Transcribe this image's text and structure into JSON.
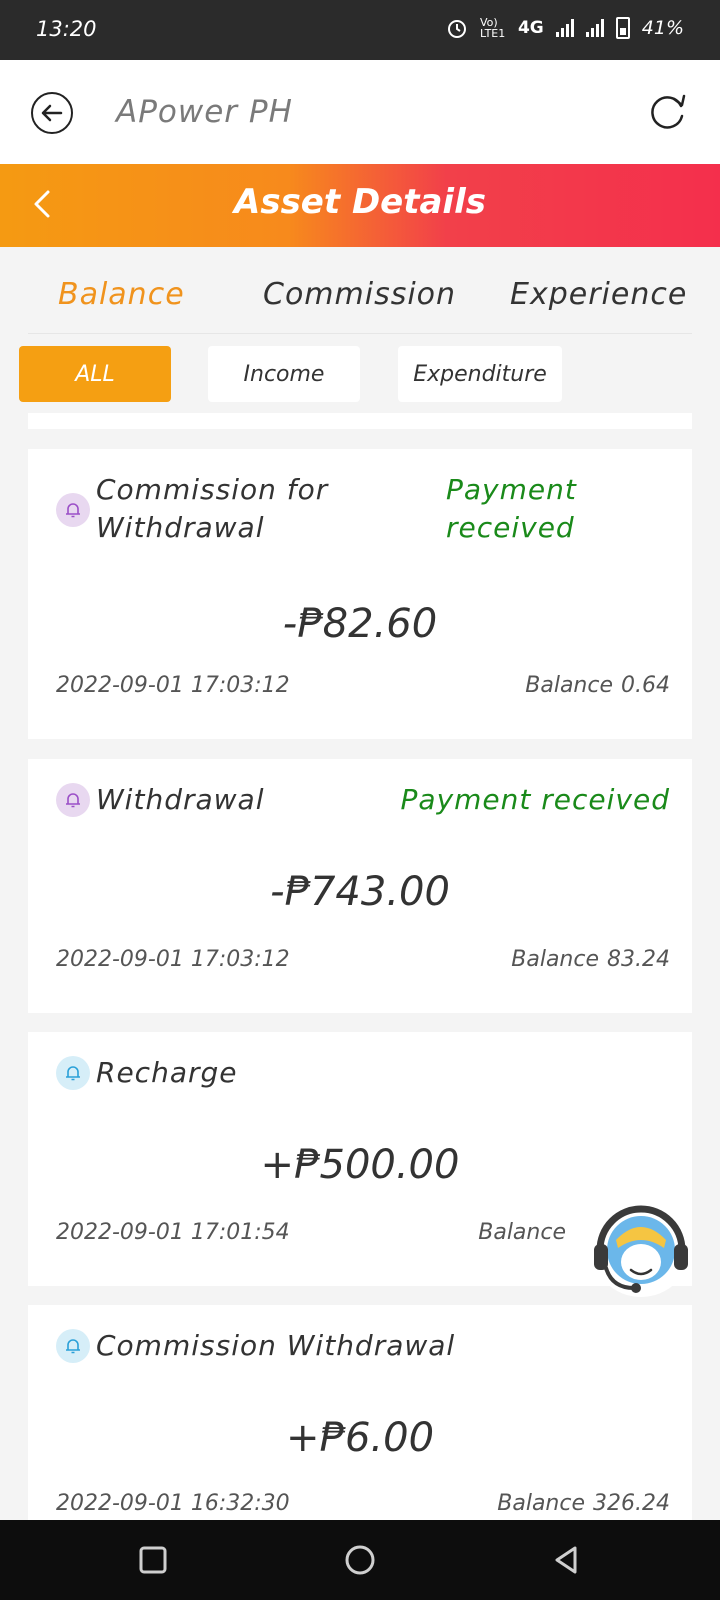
{
  "status_bar": {
    "time": "13:20",
    "network_label": "4G",
    "volte_label": "Vo) LTE1",
    "battery": "41%"
  },
  "browser": {
    "title": "APower PH",
    "back_icon": "circle-arrow-left-icon",
    "refresh_icon": "refresh-icon"
  },
  "header": {
    "title": "Asset Details",
    "back_icon": "chevron-left-icon"
  },
  "tabs": [
    {
      "label": "Balance",
      "active": true
    },
    {
      "label": "Commission",
      "active": false
    },
    {
      "label": "Experience",
      "active": false
    }
  ],
  "filters": [
    {
      "label": "ALL",
      "active": true
    },
    {
      "label": "Income",
      "active": false
    },
    {
      "label": "Expenditure",
      "active": false
    }
  ],
  "transactions": [
    {
      "title_line1": "Commission for",
      "title_line2": "Withdrawal",
      "status_line1": "Payment",
      "status_line2": "received",
      "amount": "-₱82.60",
      "datetime": "2022-09-01 17:03:12",
      "balance_label": "Balance",
      "balance_value": "0.64",
      "icon": "bell-icon",
      "icon_color": "purple"
    },
    {
      "title": "Withdrawal",
      "status": "Payment received",
      "amount": "-₱743.00",
      "datetime": "2022-09-01 17:03:12",
      "balance_label": "Balance",
      "balance_value": "83.24",
      "icon": "bell-icon",
      "icon_color": "purple"
    },
    {
      "title": "Recharge",
      "status": "",
      "amount": "+₱500.00",
      "datetime": "2022-09-01 17:01:54",
      "balance_label": "Balance",
      "balance_value": "",
      "icon": "bell-icon",
      "icon_color": "blue"
    },
    {
      "title": "Commission Withdrawal",
      "status": "",
      "amount": "+₱6.00",
      "datetime": "2022-09-01 16:32:30",
      "balance_label": "Balance",
      "balance_value": "326.24",
      "icon": "bell-icon",
      "icon_color": "blue"
    }
  ],
  "support": {
    "icon": "customer-service-icon"
  },
  "colors": {
    "accent_orange": "#f59f12",
    "header_red": "#f42f4c",
    "status_green": "#1a8a1a"
  }
}
